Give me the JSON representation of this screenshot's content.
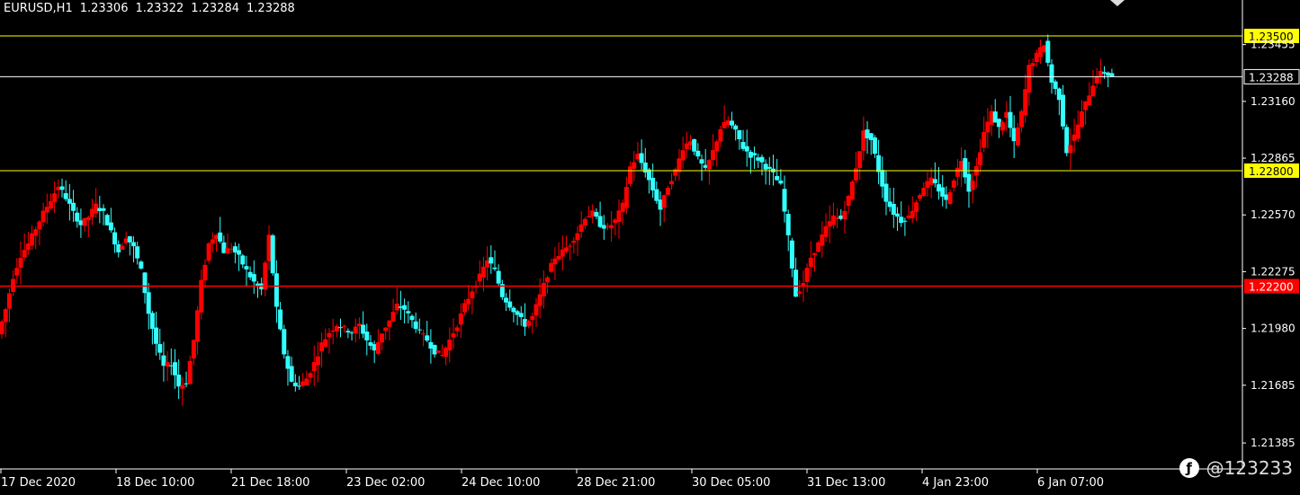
{
  "header": {
    "symbol": "EURUSD,H1",
    "open": "1.23306",
    "high": "1.23322",
    "low": "1.23284",
    "close": "1.23288"
  },
  "watermark": {
    "text": "@123233"
  },
  "colors": {
    "background": "#000000",
    "bull": "#ff0000",
    "bear": "#33ffff",
    "level": "#ffff00",
    "support": "#ff0000",
    "axis": "#ffffff"
  },
  "chart_data": {
    "type": "candlestick",
    "ylim": [
      1.2125,
      1.2364
    ],
    "y_ticks": [
      "1.23455",
      "1.23160",
      "1.22865",
      "1.22570",
      "1.22275",
      "1.21980",
      "1.21685",
      "1.21385"
    ],
    "x_ticks": [
      "17 Dec 2020",
      "18 Dec 10:00",
      "21 Dec 18:00",
      "23 Dec 02:00",
      "24 Dec 10:00",
      "28 Dec 21:00",
      "30 Dec 05:00",
      "31 Dec 13:00",
      "4 Jan 23:00",
      "6 Jan 07:00"
    ],
    "horizontal_lines": [
      {
        "price": 1.235,
        "label": "1.23500",
        "color": "#ffff00"
      },
      {
        "price": 1.23288,
        "label": "1.23288",
        "color": "#ffffff"
      },
      {
        "price": 1.228,
        "label": "1.22800",
        "color": "#ffff00"
      },
      {
        "price": 1.222,
        "label": "1.22200",
        "color": "#ff0000"
      }
    ],
    "close_path": [
      1.2195,
      1.2208,
      1.2225,
      1.2236,
      1.2242,
      1.225,
      1.2258,
      1.2265,
      1.2272,
      1.2266,
      1.2258,
      1.2252,
      1.2256,
      1.2262,
      1.2258,
      1.2248,
      1.2238,
      1.2246,
      1.224,
      1.2228,
      1.2206,
      1.219,
      1.2178,
      1.218,
      1.2168,
      1.217,
      1.2192,
      1.2222,
      1.2242,
      1.2248,
      1.2238,
      1.224,
      1.2235,
      1.2228,
      1.2222,
      1.2218,
      1.2246,
      1.2208,
      1.2185,
      1.217,
      1.2168,
      1.2172,
      1.218,
      1.219,
      1.2196,
      1.22,
      1.2198,
      1.2196,
      1.22,
      1.2192,
      1.2186,
      1.2196,
      1.2202,
      1.221,
      1.2208,
      1.2202,
      1.2196,
      1.2192,
      1.2186,
      1.2184,
      1.2192,
      1.22,
      1.221,
      1.2218,
      1.2225,
      1.2234,
      1.2228,
      1.2215,
      1.221,
      1.2205,
      1.22,
      1.2204,
      1.2215,
      1.2226,
      1.2235,
      1.2238,
      1.2242,
      1.2248,
      1.2256,
      1.2258,
      1.2252,
      1.225,
      1.2254,
      1.2262,
      1.2282,
      1.2288,
      1.228,
      1.227,
      1.226,
      1.2272,
      1.228,
      1.2292,
      1.2296,
      1.2286,
      1.228,
      1.229,
      1.2302,
      1.2306,
      1.23,
      1.2292,
      1.2288,
      1.2286,
      1.2282,
      1.2278,
      1.2272,
      1.2245,
      1.2215,
      1.2222,
      1.2235,
      1.2242,
      1.225,
      1.2256,
      1.2255,
      1.2266,
      1.2282,
      1.23,
      1.2296,
      1.228,
      1.2265,
      1.2258,
      1.2254,
      1.2256,
      1.2264,
      1.2272,
      1.2275,
      1.227,
      1.2264,
      1.2276,
      1.2286,
      1.227,
      1.2282,
      1.23,
      1.231,
      1.2302,
      1.231,
      1.2294,
      1.231,
      1.2334,
      1.234,
      1.2346,
      1.2326,
      1.2318,
      1.229,
      1.2298,
      1.231,
      1.232,
      1.233,
      1.2331,
      1.2329
    ]
  }
}
